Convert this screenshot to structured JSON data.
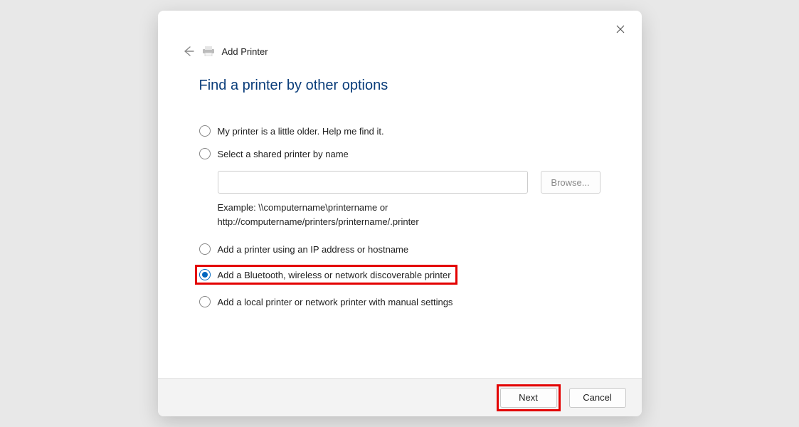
{
  "header": {
    "title": "Add Printer"
  },
  "page": {
    "title": "Find a printer by other options"
  },
  "options": {
    "older": "My printer is a little older. Help me find it.",
    "shared": "Select a shared printer by name",
    "browse_label": "Browse...",
    "example_line1": "Example: \\\\computername\\printername or",
    "example_line2": "http://computername/printers/printername/.printer",
    "tcpip": "Add a printer using an IP address or hostname",
    "bluetooth": "Add a Bluetooth, wireless or network discoverable printer",
    "manual": "Add a local printer or network printer with manual settings"
  },
  "footer": {
    "next": "Next",
    "cancel": "Cancel"
  }
}
